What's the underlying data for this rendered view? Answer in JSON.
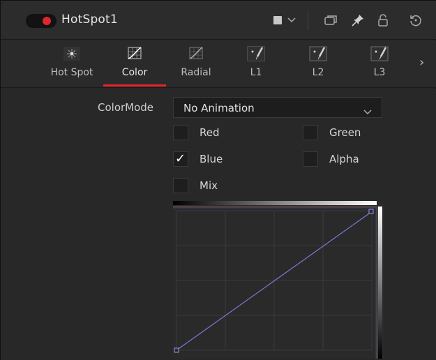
{
  "header": {
    "title": "HotSpot1",
    "enabled": true,
    "icons": [
      "color-swatch-icon",
      "chevron-down-icon",
      "window-icon",
      "pin-icon",
      "lock-icon",
      "reset-icon"
    ],
    "accent": "#e0252f"
  },
  "tabs": [
    {
      "label": "Hot Spot",
      "icon": "hotspot-icon"
    },
    {
      "label": "Color",
      "icon": "curve-icon",
      "active": true
    },
    {
      "label": "Radial",
      "icon": "curve-icon"
    },
    {
      "label": "L1",
      "icon": "lens-icon"
    },
    {
      "label": "L2",
      "icon": "lens-icon"
    },
    {
      "label": "L3",
      "icon": "lens-icon"
    }
  ],
  "color_mode": {
    "label": "ColorMode",
    "value": "No Animation"
  },
  "channels": [
    {
      "label": "Red",
      "checked": false
    },
    {
      "label": "Green",
      "checked": false
    },
    {
      "label": "Blue",
      "checked": true
    },
    {
      "label": "Alpha",
      "checked": false
    },
    {
      "label": "Mix",
      "checked": false
    }
  ],
  "curve": {
    "points": [
      [
        0,
        0
      ],
      [
        1,
        1
      ]
    ],
    "line_color": "#7b7bd8"
  }
}
